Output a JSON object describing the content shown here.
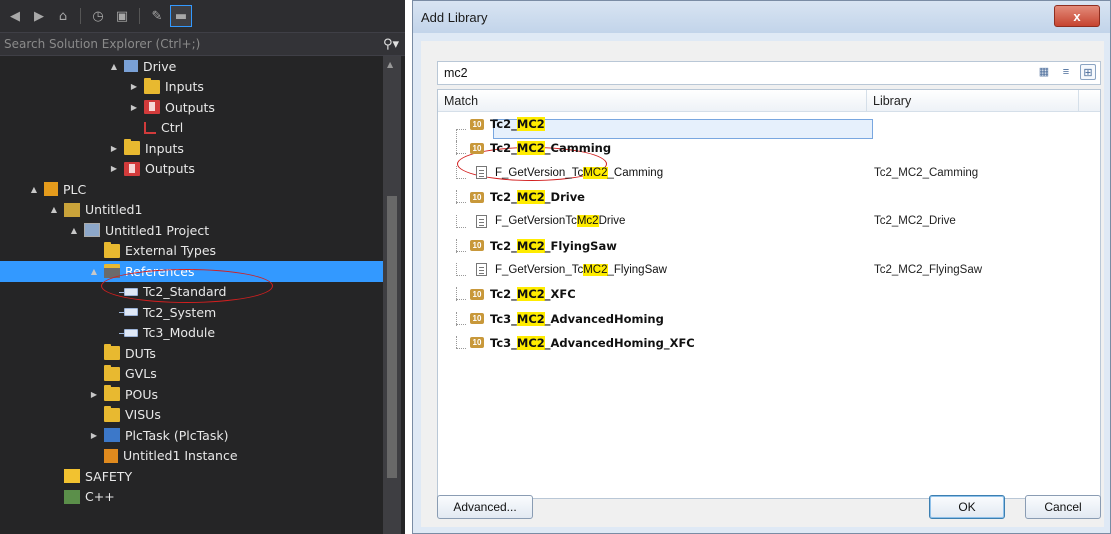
{
  "explorer": {
    "search_placeholder": "Search Solution Explorer (Ctrl+;)",
    "tree": [
      {
        "indent": 124,
        "arrow": "▲",
        "icon": "drive",
        "label": "Drive"
      },
      {
        "indent": 144,
        "arrow": "▶",
        "icon": "folder-y",
        "label": "Inputs"
      },
      {
        "indent": 144,
        "arrow": "▶",
        "icon": "folder-r",
        "label": "Outputs"
      },
      {
        "indent": 144,
        "arrow": "",
        "icon": "ctrl",
        "label": "Ctrl"
      },
      {
        "indent": 124,
        "arrow": "▶",
        "icon": "folder-y",
        "label": "Inputs"
      },
      {
        "indent": 124,
        "arrow": "▶",
        "icon": "folder-r",
        "label": "Outputs"
      },
      {
        "indent": 44,
        "arrow": "▲",
        "icon": "plc",
        "label": "PLC"
      },
      {
        "indent": 64,
        "arrow": "▲",
        "icon": "proj",
        "label": "Untitled1"
      },
      {
        "indent": 84,
        "arrow": "▲",
        "icon": "proj2",
        "label": "Untitled1 Project"
      },
      {
        "indent": 104,
        "arrow": "",
        "icon": "folder-y",
        "label": "External Types"
      },
      {
        "indent": 104,
        "arrow": "▲",
        "icon": "folder-b",
        "label": "References",
        "selected": true
      },
      {
        "indent": 124,
        "arrow": "",
        "icon": "ref",
        "label": "Tc2_Standard"
      },
      {
        "indent": 124,
        "arrow": "",
        "icon": "ref",
        "label": "Tc2_System"
      },
      {
        "indent": 124,
        "arrow": "",
        "icon": "ref",
        "label": "Tc3_Module"
      },
      {
        "indent": 104,
        "arrow": "",
        "icon": "folder-y",
        "label": "DUTs"
      },
      {
        "indent": 104,
        "arrow": "",
        "icon": "folder-y",
        "label": "GVLs"
      },
      {
        "indent": 104,
        "arrow": "▶",
        "icon": "folder-y",
        "label": "POUs"
      },
      {
        "indent": 104,
        "arrow": "",
        "icon": "folder-y",
        "label": "VISUs"
      },
      {
        "indent": 104,
        "arrow": "▶",
        "icon": "task",
        "label": "PlcTask (PlcTask)"
      },
      {
        "indent": 104,
        "arrow": "",
        "icon": "inst",
        "label": "Untitled1 Instance"
      },
      {
        "indent": 64,
        "arrow": "",
        "icon": "safety",
        "label": "SAFETY"
      },
      {
        "indent": 64,
        "arrow": "",
        "icon": "cpp",
        "label": "C++"
      }
    ]
  },
  "dialog": {
    "title": "Add Library",
    "close_label": "x",
    "search_value": "mc2",
    "col_match": "Match",
    "col_library": "Library",
    "rows": [
      {
        "type": "lib",
        "pre": "Tc2_",
        "hl": "MC2",
        "post": "",
        "library": "",
        "selected": true
      },
      {
        "type": "lib",
        "pre": "Tc2_",
        "hl": "MC2",
        "post": "_Camming",
        "library": ""
      },
      {
        "type": "fn",
        "pre": "F_GetVersion_Tc",
        "hl": "MC2",
        "post": "_Camming",
        "library": "Tc2_MC2_Camming"
      },
      {
        "type": "lib",
        "pre": "Tc2_",
        "hl": "MC2",
        "post": "_Drive",
        "library": ""
      },
      {
        "type": "fn",
        "pre": "F_GetVersionTc",
        "hl": "Mc2",
        "post": "Drive",
        "library": "Tc2_MC2_Drive"
      },
      {
        "type": "lib",
        "pre": "Tc2_",
        "hl": "MC2",
        "post": "_FlyingSaw",
        "library": ""
      },
      {
        "type": "fn",
        "pre": "F_GetVersion_Tc",
        "hl": "MC2",
        "post": "_FlyingSaw",
        "library": "Tc2_MC2_FlyingSaw"
      },
      {
        "type": "lib",
        "pre": "Tc2_",
        "hl": "MC2",
        "post": "_XFC",
        "library": ""
      },
      {
        "type": "lib",
        "pre": "Tc3_",
        "hl": "MC2",
        "post": "_AdvancedHoming",
        "library": ""
      },
      {
        "type": "lib",
        "pre": "Tc3_",
        "hl": "MC2",
        "post": "_AdvancedHoming_XFC",
        "library": ""
      }
    ],
    "lib_icon_text": "10",
    "buttons": {
      "advanced": "Advanced...",
      "ok": "OK",
      "cancel": "Cancel"
    }
  }
}
